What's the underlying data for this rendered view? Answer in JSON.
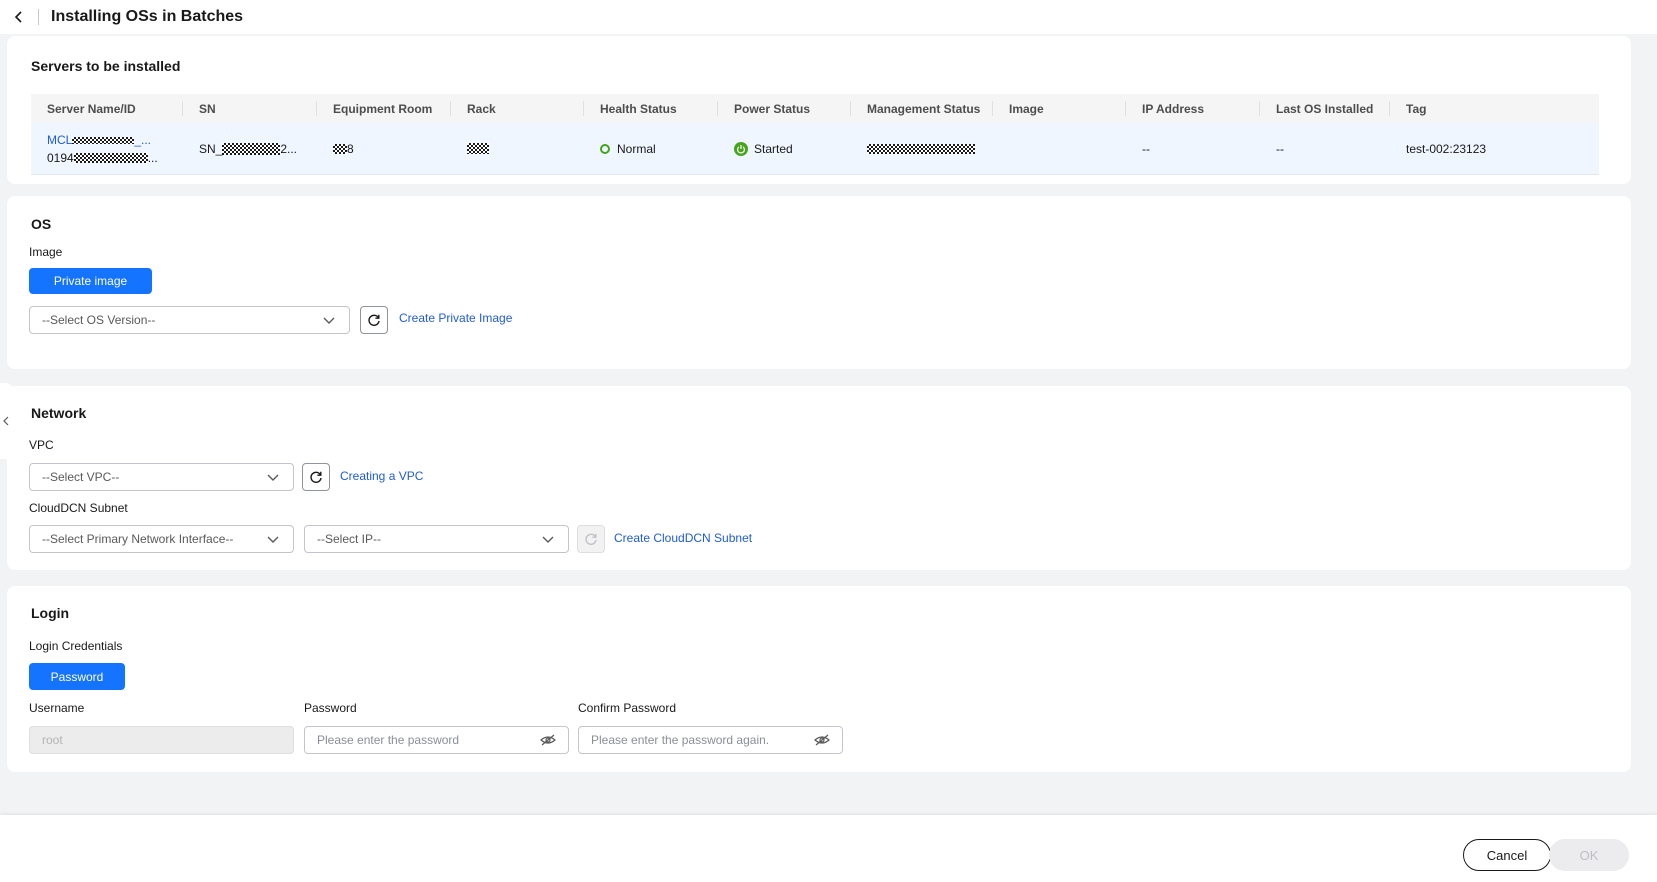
{
  "header": {
    "title": "Installing OSs in Batches"
  },
  "servers_section": {
    "title": "Servers to be installed",
    "columns": [
      "Server Name/ID",
      "SN",
      "Equipment Room",
      "Rack",
      "Health Status",
      "Power Status",
      "Management Status",
      "Image",
      "IP Address",
      "Last OS Installed",
      "Tag"
    ],
    "row": {
      "name_prefix": "MCL",
      "name_suffix": "_...",
      "id_prefix": "0194",
      "id_suffix": "...",
      "sn_prefix": "SN_",
      "sn_suffix": "2...",
      "room_suffix": "8",
      "health": "Normal",
      "power": "Started",
      "ip": "--",
      "last_os": "--",
      "tag": "test-002:23123"
    }
  },
  "os_section": {
    "title": "OS",
    "image_label": "Image",
    "image_button": "Private image",
    "os_version_placeholder": "--Select OS Version--",
    "create_link": "Create Private Image"
  },
  "network_section": {
    "title": "Network",
    "vpc_label": "VPC",
    "vpc_placeholder": "--Select VPC--",
    "vpc_link": "Creating a VPC",
    "subnet_label": "CloudDCN Subnet",
    "nic_placeholder": "--Select Primary Network Interface--",
    "ip_placeholder": "--Select IP--",
    "subnet_link": "Create CloudDCN Subnet"
  },
  "login_section": {
    "title": "Login",
    "credentials_label": "Login Credentials",
    "credentials_button": "Password",
    "username_label": "Username",
    "username_value": "root",
    "password_label": "Password",
    "password_placeholder": "Please enter the password",
    "confirm_label": "Confirm Password",
    "confirm_placeholder": "Please enter the password again."
  },
  "footer": {
    "cancel": "Cancel",
    "ok": "OK"
  },
  "colors": {
    "primary": "#1474ff",
    "link": "#1f5cd8",
    "success": "#46a51a"
  }
}
